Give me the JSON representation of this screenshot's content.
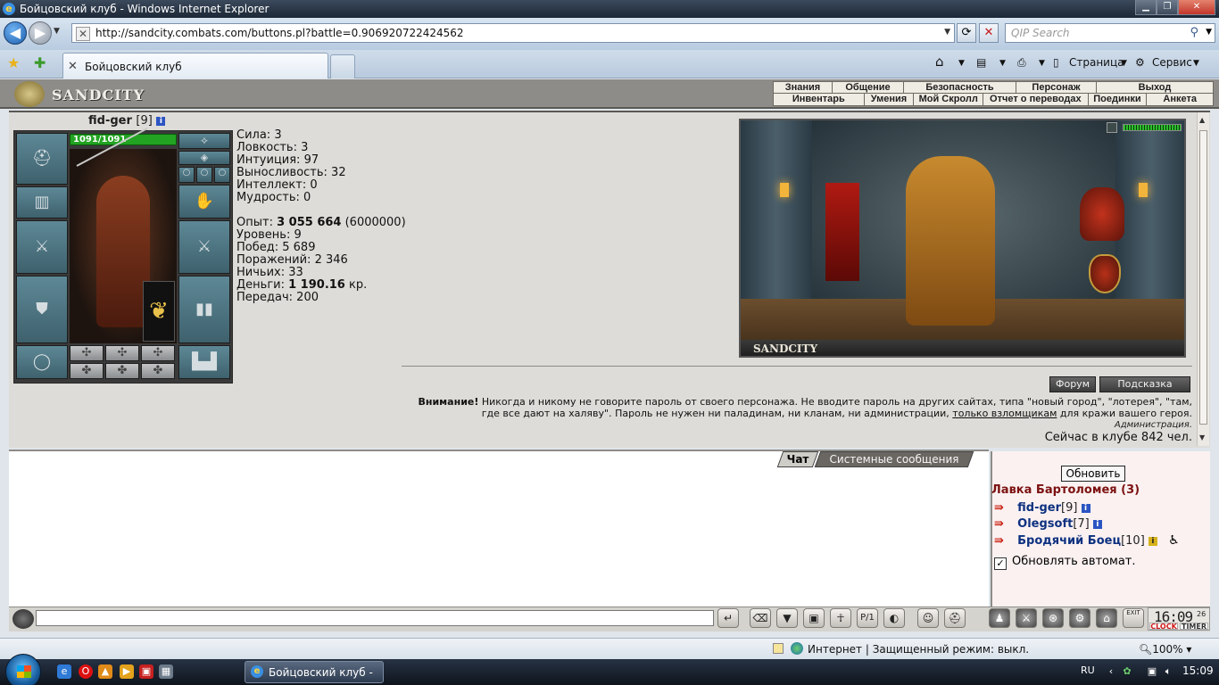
{
  "window": {
    "title": "Бойцовский клуб - Windows Internet Explorer"
  },
  "browser": {
    "url": "http://sandcity.combats.com/buttons.pl?battle=0.906920722424562",
    "search_placeholder": "QIP Search",
    "tab_label": "Бойцовский клуб",
    "tools": {
      "page": "Страница",
      "service": "Сервис"
    }
  },
  "game": {
    "logo": "SANDCITY",
    "top_menu": [
      "Знания",
      "Общение",
      "Безопасность",
      "Персонаж",
      "Выход"
    ],
    "sub_menu": [
      "Инвентарь",
      "Умения",
      "Мой Скролл",
      "Отчет о переводах",
      "Поединки",
      "Анкета"
    ],
    "character": {
      "name": "fid-ger",
      "level": "[9]",
      "hp": "1091/1091",
      "hp_fraction": 1.0
    },
    "stats": {
      "strength": "Сила: 3",
      "agility": "Ловкость: 3",
      "intuition": "Интуиция: 97",
      "endurance": "Выносливость: 32",
      "intellect": "Интеллект: 0",
      "wisdom": "Мудрость: 0",
      "exp_label": "Опыт: ",
      "exp_value": "3 055 664",
      "exp_next": " (6000000)",
      "level": "Уровень: 9",
      "wins": "Побед: 5 689",
      "losses": "Поражений: 2 346",
      "draws": "Ничьих: 33",
      "money_label": "Деньги: ",
      "money_value": "1 190.16",
      "money_unit": " кр.",
      "transfers": "Передач: 200"
    },
    "scene_label": "SANDCITY",
    "buttons": {
      "forum": "Форум",
      "hint": "Подсказка"
    },
    "warning": {
      "bold": "Внимание!",
      "text1": " Никогда и никому не говорите пароль от своего персонажа. Не вводите пароль на других сайтах, типа \"новый город\", \"лотерея\", \"там, где все дают на халяву\". Пароль не нужен ни паладинам, ни кланам, ни администрации, ",
      "link": "только взломщикам",
      "text2": " для кражи вашего героя.",
      "admin": "Администрация.",
      "online": "Сейчас в клубе 842 чел."
    },
    "chat_tabs": {
      "chat": "Чат",
      "system": "Системные сообщения"
    },
    "room": {
      "refresh": "Обновить",
      "name": "Лавка Бартоломея (3)",
      "users": [
        {
          "name": "fid-ger",
          "level": "[9]"
        },
        {
          "name": "Olegsoft",
          "level": "[7]"
        },
        {
          "name": "Бродячий Боец",
          "level": "[10]"
        }
      ],
      "auto_update": "Обновлять автомат."
    },
    "clock": {
      "time": "16:09",
      "seconds": "26",
      "clock_label": "CLOCK",
      "timer_label": "TIMER"
    },
    "toolbar_exit": "EXIT"
  },
  "statusbar": {
    "zone": "Интернет | Защищенный режим: выкл.",
    "zoom": "100%"
  },
  "taskbar": {
    "task": "Бойцовский клуб - ...",
    "lang": "RU",
    "time": "15:09"
  }
}
